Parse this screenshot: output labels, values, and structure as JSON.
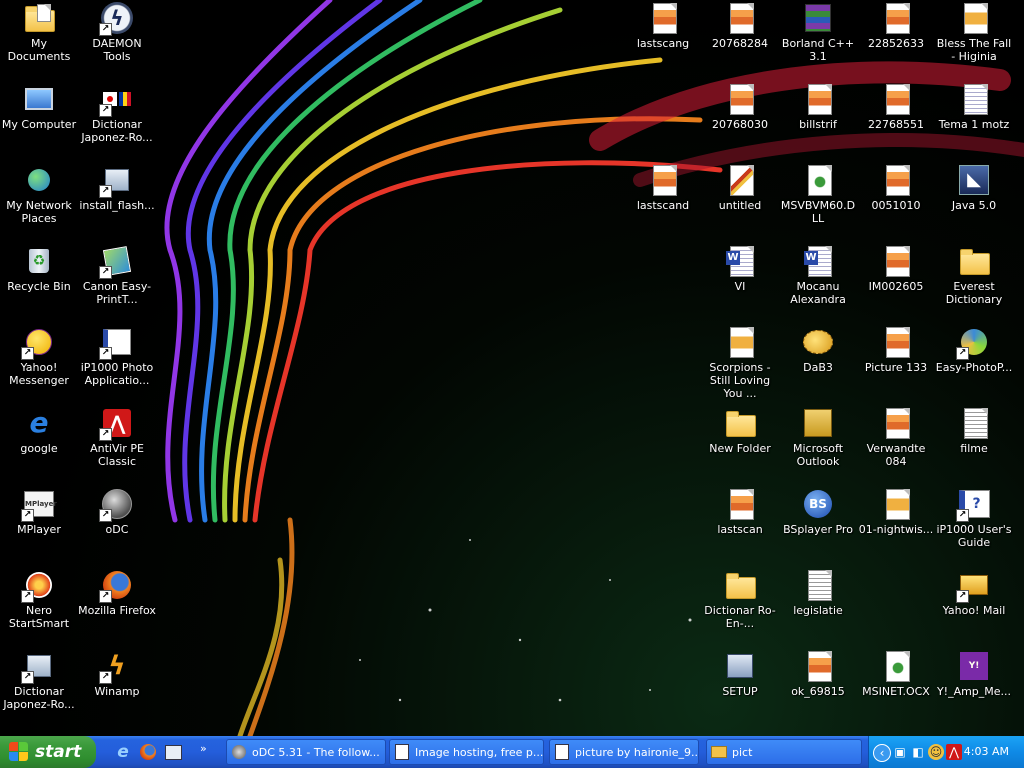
{
  "left_icons": [
    {
      "label": "My Documents",
      "icon": "my-documents-icon"
    },
    {
      "label": "DAEMON Tools",
      "icon": "daemon-tools-icon"
    },
    {
      "label": "My Computer",
      "icon": "my-computer-icon"
    },
    {
      "label": "Dictionar Japonez-Ro...",
      "icon": "dictionary-shortcut-icon"
    },
    {
      "label": "My Network Places",
      "icon": "network-places-icon"
    },
    {
      "label": "install_flash...",
      "icon": "installer-icon"
    },
    {
      "label": "Recycle Bin",
      "icon": "recycle-bin-icon"
    },
    {
      "label": "Canon Easy-PrintT...",
      "icon": "canon-icon"
    },
    {
      "label": "Yahoo! Messenger",
      "icon": "yahoo-messenger-icon"
    },
    {
      "label": "iP1000 Photo Applicatio...",
      "icon": "photo-app-icon"
    },
    {
      "label": "google",
      "icon": "internet-explorer-icon"
    },
    {
      "label": "AntiVir PE Classic",
      "icon": "antivir-icon"
    },
    {
      "label": "MPlayer",
      "icon": "mplayer-icon"
    },
    {
      "label": "oDC",
      "icon": "odc-icon"
    },
    {
      "label": "Nero StartSmart",
      "icon": "nero-icon"
    },
    {
      "label": "Mozilla Firefox",
      "icon": "firefox-icon"
    },
    {
      "label": "Dictionar Japonez-Ro...",
      "icon": "dictionary-installer-icon"
    },
    {
      "label": "Winamp",
      "icon": "winamp-icon"
    }
  ],
  "right_icons": [
    {
      "label": "lastscang",
      "icon": "image-file-icon"
    },
    {
      "label": "20768284",
      "icon": "image-file-icon"
    },
    {
      "label": "Borland C++ 3.1",
      "icon": "archive-icon"
    },
    {
      "label": "22852633",
      "icon": "image-file-icon"
    },
    {
      "label": "Bless The Fall - Higinia",
      "icon": "media-file-icon"
    },
    {
      "label": "20768030",
      "icon": "image-file-icon"
    },
    {
      "label": "billstrif",
      "icon": "image-file-icon"
    },
    {
      "label": "22768551",
      "icon": "image-file-icon"
    },
    {
      "label": "Tema 1 motz",
      "icon": "word-document-icon"
    },
    {
      "label": "lastscand",
      "icon": "image-file-icon"
    },
    {
      "label": "untitled",
      "icon": "paint-file-icon"
    },
    {
      "label": "MSVBVM60.DLL",
      "icon": "dll-file-icon"
    },
    {
      "label": "0051010",
      "icon": "image-file-icon"
    },
    {
      "label": "Java 5.0",
      "icon": "java-icon"
    },
    {
      "label": "VI",
      "icon": "word-document-icon"
    },
    {
      "label": "Mocanu Alexandra",
      "icon": "word-document-icon"
    },
    {
      "label": "IM002605",
      "icon": "image-file-icon"
    },
    {
      "label": "Everest Dictionary",
      "icon": "folder-icon"
    },
    {
      "label": "Scorpions - Still Loving You ...",
      "icon": "media-file-icon"
    },
    {
      "label": "DaB3",
      "icon": "pufferfish-icon"
    },
    {
      "label": "Picture 133",
      "icon": "image-file-icon"
    },
    {
      "label": "Easy-PhotoP...",
      "icon": "easy-photo-icon"
    },
    {
      "label": "New Folder",
      "icon": "folder-icon"
    },
    {
      "label": "Microsoft Outlook",
      "icon": "outlook-icon"
    },
    {
      "label": "Verwandte 084",
      "icon": "image-file-icon"
    },
    {
      "label": "filme",
      "icon": "text-file-icon"
    },
    {
      "label": "lastscan",
      "icon": "image-file-icon"
    },
    {
      "label": "BSplayer Pro",
      "icon": "bsplayer-icon"
    },
    {
      "label": "01-nightwis...",
      "icon": "media-file-icon"
    },
    {
      "label": "iP1000 User's Guide",
      "icon": "help-guide-icon"
    },
    {
      "label": "Dictionar Ro-En-...",
      "icon": "folder-icon"
    },
    {
      "label": "legislatie",
      "icon": "text-file-icon"
    },
    {
      "label": "Yahoo! Mail",
      "icon": "yahoo-mail-icon"
    },
    {
      "label": "SETUP",
      "icon": "setup-icon"
    },
    {
      "label": "ok_69815",
      "icon": "image-file-icon"
    },
    {
      "label": "MSINET.OCX",
      "icon": "dll-file-icon"
    },
    {
      "label": "Y!_Amp_Me...",
      "icon": "yahoo-amp-icon"
    }
  ],
  "taskbar": {
    "start_label": "start",
    "quick_launch": [
      "internet-explorer-icon",
      "firefox-icon",
      "show-desktop-icon"
    ],
    "overflow": "»",
    "tasks": [
      {
        "label": "oDC 5.31 - The follow..."
      },
      {
        "label": "Image hosting, free p..."
      },
      {
        "label": "picture by haironie_9..."
      },
      {
        "label": "pict"
      }
    ],
    "clock": "4:03 AM"
  },
  "colors": {
    "taskbar": "#245edb",
    "start": "#3b9a3b",
    "tray": "#0f8ae6"
  }
}
